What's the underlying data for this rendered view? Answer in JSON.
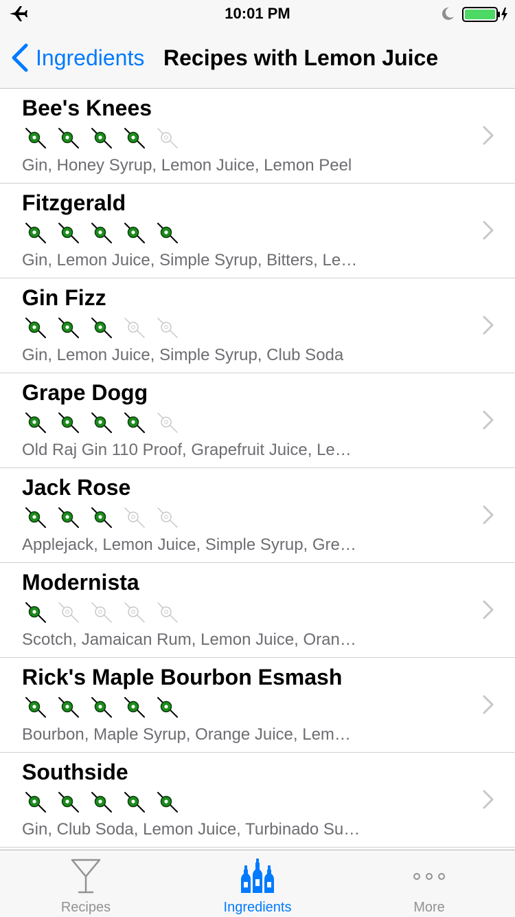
{
  "status": {
    "time": "10:01 PM"
  },
  "nav": {
    "back_label": "Ingredients",
    "title": "Recipes with Lemon Juice"
  },
  "recipes": [
    {
      "name": "Bee's Knees",
      "rating": 4,
      "ingredients": "Gin, Honey Syrup, Lemon Juice, Lemon Peel"
    },
    {
      "name": "Fitzgerald",
      "rating": 5,
      "ingredients": "Gin, Lemon Juice, Simple Syrup, Bitters, Le…"
    },
    {
      "name": "Gin Fizz",
      "rating": 3,
      "ingredients": "Gin, Lemon Juice, Simple Syrup, Club Soda"
    },
    {
      "name": "Grape Dogg",
      "rating": 4,
      "ingredients": "Old Raj Gin 110 Proof, Grapefruit Juice, Le…"
    },
    {
      "name": "Jack Rose",
      "rating": 3,
      "ingredients": "Applejack, Lemon Juice, Simple Syrup, Gre…"
    },
    {
      "name": "Modernista",
      "rating": 1,
      "ingredients": "Scotch, Jamaican Rum, Lemon Juice, Oran…"
    },
    {
      "name": "Rick's Maple Bourbon Esmash",
      "rating": 5,
      "ingredients": "Bourbon, Maple Syrup, Orange Juice, Lem…"
    },
    {
      "name": "Southside",
      "rating": 5,
      "ingredients": "Gin, Club Soda, Lemon Juice, Turbinado Su…"
    }
  ],
  "rating_max": 5,
  "tabs": [
    {
      "label": "Recipes",
      "icon": "martini-glass-icon",
      "active": false
    },
    {
      "label": "Ingredients",
      "icon": "bottles-icon",
      "active": true
    },
    {
      "label": "More",
      "icon": "more-dots-icon",
      "active": false
    }
  ],
  "colors": {
    "accent": "#007aff",
    "olive_green": "#1e8c1e",
    "secondary_text": "#6d6d72"
  }
}
